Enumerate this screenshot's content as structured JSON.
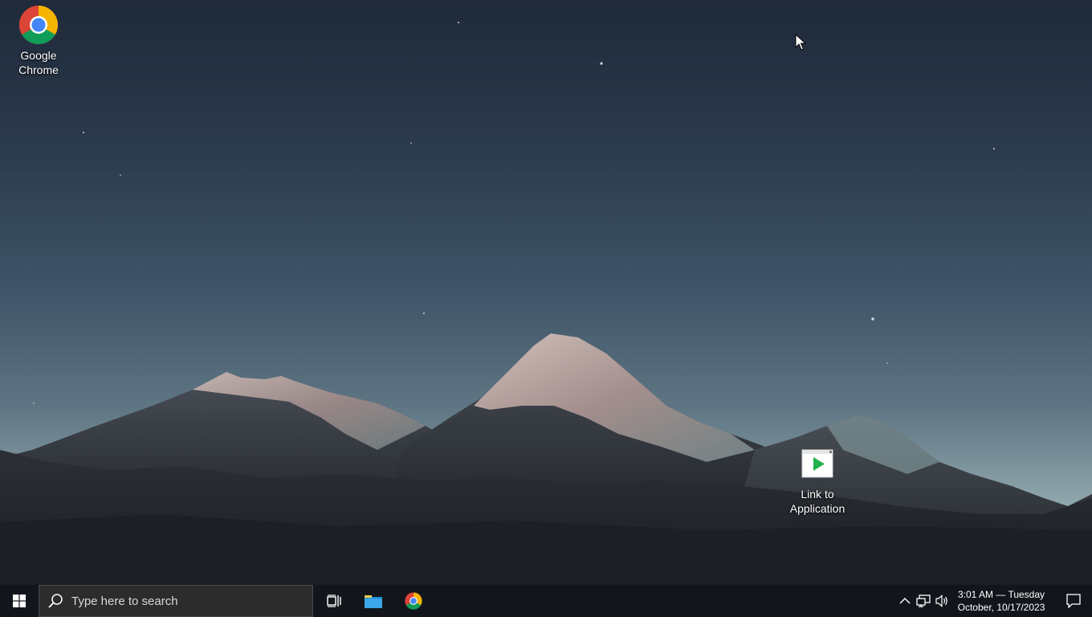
{
  "desktop": {
    "icons": [
      {
        "label": "Google Chrome",
        "icon": "chrome-icon"
      },
      {
        "label": "Link to Application",
        "icon": "application-shortcut-icon"
      }
    ]
  },
  "taskbar": {
    "start_icon": "windows-logo-icon",
    "search": {
      "placeholder": "Type here to search",
      "icon": "search-icon"
    },
    "pinned": [
      {
        "name": "Task View",
        "icon": "task-view-icon"
      },
      {
        "name": "File Explorer",
        "icon": "folder-icon"
      },
      {
        "name": "Google Chrome",
        "icon": "chrome-icon"
      }
    ],
    "tray": {
      "icons": [
        "chevron-up-icon",
        "network-icon",
        "volume-icon",
        "notification-icon"
      ],
      "time_line": "3:01 AM — Tuesday",
      "date_line": "October, 10/17/2023"
    }
  },
  "colors": {
    "taskbar": "#12161c",
    "search_box": "#2c2c2c",
    "sky_top": "#1f2a3a",
    "sky_horizon": "#aebfc2",
    "chrome_red": "#db4437",
    "chrome_green": "#0f9d58",
    "chrome_yellow": "#f4b400",
    "chrome_blue": "#4285f4",
    "folder": "#1e90d6"
  }
}
